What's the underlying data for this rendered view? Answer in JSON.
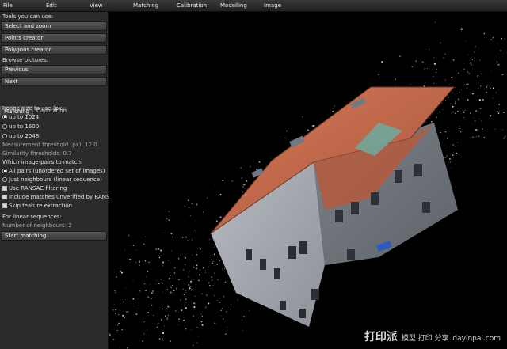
{
  "menu": [
    "File",
    "Edit",
    "View",
    "Matching",
    "Calibration",
    "Modelling",
    "Image"
  ],
  "panel": {
    "tools_label": "Tools you can use:",
    "tools": [
      "Select and zoom",
      "Points creator",
      "Polygons creator"
    ],
    "browse_label": "Browse pictures:",
    "browse": [
      "Previous",
      "Next"
    ],
    "tabs": [
      "Matching",
      "Calibration"
    ],
    "image_size_label": "Image size to use (px):",
    "image_sizes": [
      "up to 1024",
      "up to 1600",
      "up to 2048"
    ],
    "measurement_threshold": "Measurement threshold (px): 12.0",
    "similarity_threshold": "Similarity thresholds: 0.7",
    "pairs_label": "Which image-pairs to match:",
    "pair_options": [
      "All pairs (unordered set of images)",
      "Just neighbours (linear sequence)"
    ],
    "checks": [
      "Use RANSAC filtering",
      "Include matches unverified by RANSAC",
      "Skip feature extraction"
    ],
    "linear_label": "For linear sequences:",
    "neighbours": "Number of neighbours: 2",
    "start_button": "Start matching"
  },
  "watermark": {
    "brand": "打印派",
    "sub1": "模型 打印 分享",
    "sub2": "dayinpai.com"
  },
  "colors": {
    "panel": "#2b2b2b",
    "button": "#474747",
    "roof": "#c8694a",
    "wall": "#bfc3c8"
  }
}
